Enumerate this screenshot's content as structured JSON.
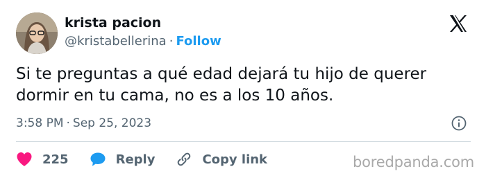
{
  "author": {
    "display_name": "krista pacion",
    "handle": "@kristabellerina",
    "separator": "·",
    "follow_label": "Follow"
  },
  "tweet": {
    "text": "Si te preguntas a qué edad dejará tu hijo de querer dormir en tu cama, no es a los 10 años."
  },
  "meta": {
    "time": "3:58 PM",
    "separator": "·",
    "date": "Sep 25, 2023"
  },
  "actions": {
    "like_count": "225",
    "reply_label": "Reply",
    "copy_label": "Copy link"
  },
  "watermark": "boredpanda.com",
  "colors": {
    "accent": "#1d9bf0",
    "like": "#f91880",
    "text": "#0f1419",
    "muted": "#536471"
  },
  "icons": {
    "brand": "x-logo-icon",
    "info": "info-icon",
    "like": "heart-icon",
    "reply": "speech-bubble-icon",
    "copy": "link-icon"
  }
}
